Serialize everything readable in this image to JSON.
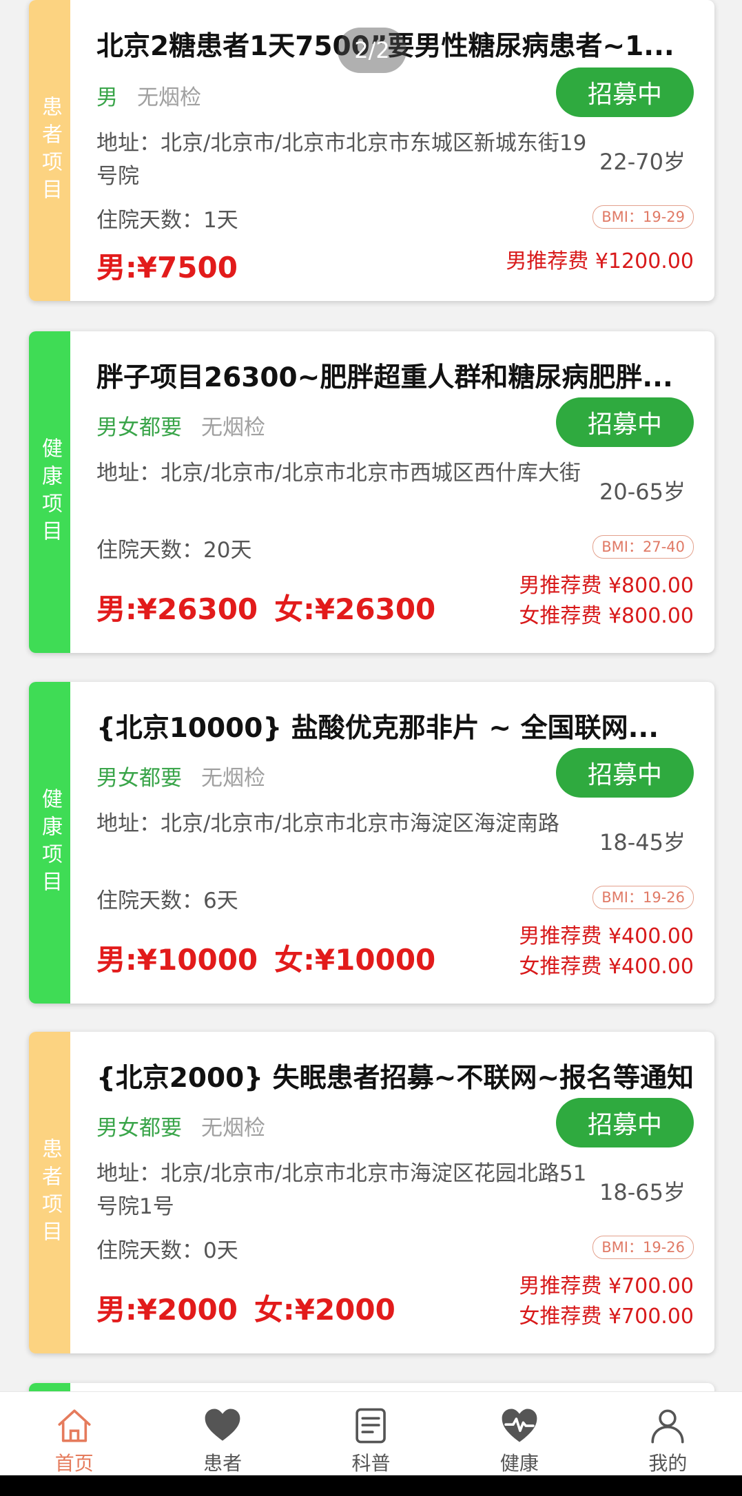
{
  "pager": {
    "text": "2/2"
  },
  "cards": [
    {
      "category": "患者项目",
      "title": "北京2糖患者1天7500”要男性糖尿病患者~1...",
      "sex": "男",
      "smoke": "无烟检",
      "status": "招募中",
      "address": "地址：北京/北京市/北京市北京市东城区新城东街19号院",
      "age": "22-70岁",
      "days": "住院天数：1天",
      "bmi": "BMI：19-29",
      "price_m": "男:¥7500",
      "price_f": "",
      "fee_m": "男推荐费 ¥1200.00",
      "fee_f": ""
    },
    {
      "category": "健康项目",
      "title": "胖子项目26300~肥胖超重人群和糖尿病肥胖...",
      "sex": "男女都要",
      "smoke": "无烟检",
      "status": "招募中",
      "address": "地址：北京/北京市/北京市北京市西城区西什库大街",
      "age": "20-65岁",
      "days": "住院天数：20天",
      "bmi": "BMI：27-40",
      "price_m": "男:¥26300",
      "price_f": "女:¥26300",
      "fee_m": "男推荐费 ¥800.00",
      "fee_f": "女推荐费 ¥800.00"
    },
    {
      "category": "健康项目",
      "title": "{北京10000} 盐酸优克那非片 ~ 全国联网...",
      "sex": "男女都要",
      "smoke": "无烟检",
      "status": "招募中",
      "address": "地址：北京/北京市/北京市北京市海淀区海淀南路",
      "age": "18-45岁",
      "days": "住院天数：6天",
      "bmi": "BMI：19-26",
      "price_m": "男:¥10000",
      "price_f": "女:¥10000",
      "fee_m": "男推荐费 ¥400.00",
      "fee_f": "女推荐费 ¥400.00"
    },
    {
      "category": "患者项目",
      "title": "{北京2000} 失眠患者招募~不联网~报名等通知",
      "sex": "男女都要",
      "smoke": "无烟检",
      "status": "招募中",
      "address": "地址：北京/北京市/北京市北京市海淀区花园北路51号院1号",
      "age": "18-65岁",
      "days": "住院天数：0天",
      "bmi": "BMI：19-26",
      "price_m": "男:¥2000",
      "price_f": "女:¥2000",
      "fee_m": "男推荐费 ¥700.00",
      "fee_f": "女推荐费 ¥700.00"
    }
  ],
  "tabbar": {
    "items": [
      {
        "label": "首页",
        "icon": "home-icon",
        "active": true
      },
      {
        "label": "患者",
        "icon": "heart-icon",
        "active": false
      },
      {
        "label": "科普",
        "icon": "document-icon",
        "active": false
      },
      {
        "label": "健康",
        "icon": "heart-pulse-icon",
        "active": false
      },
      {
        "label": "我的",
        "icon": "user-icon",
        "active": false
      }
    ]
  },
  "colors": {
    "accent_red": "#e21b1b",
    "status_green": "#2faa3f",
    "patient_strip": "#fcd381",
    "health_strip": "#3fdc55",
    "tab_active": "#e57b5c"
  }
}
